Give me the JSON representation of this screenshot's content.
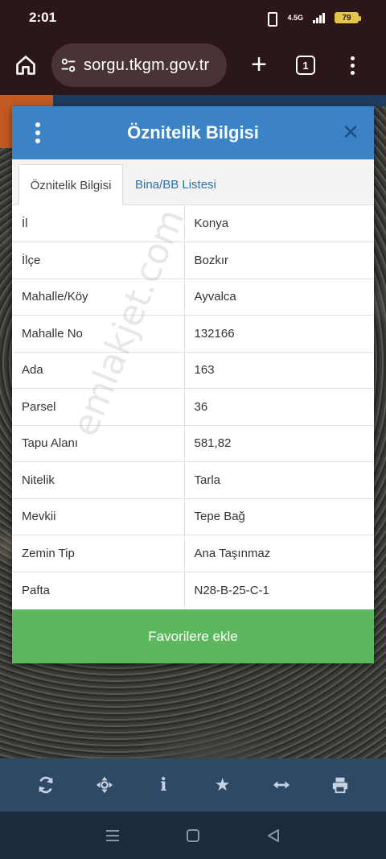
{
  "status_bar": {
    "time": "2:01",
    "network": "4.5G",
    "battery": "79"
  },
  "browser": {
    "url": "sorgu.tkgm.gov.tr",
    "tab_count": "1"
  },
  "dialog": {
    "title": "Öznitelik Bilgisi",
    "close_label": "✕",
    "tabs": [
      {
        "label": "Öznitelik Bilgisi",
        "active": true
      },
      {
        "label": "Bina/BB Listesi",
        "active": false
      }
    ],
    "rows": [
      {
        "key": "İl",
        "value": "Konya"
      },
      {
        "key": "İlçe",
        "value": "Bozkır"
      },
      {
        "key": "Mahalle/Köy",
        "value": "Ayvalca"
      },
      {
        "key": "Mahalle No",
        "value": "132166"
      },
      {
        "key": "Ada",
        "value": "163"
      },
      {
        "key": "Parsel",
        "value": "36"
      },
      {
        "key": "Tapu Alanı",
        "value": "581,82"
      },
      {
        "key": "Nitelik",
        "value": "Tarla"
      },
      {
        "key": "Mevkii",
        "value": "Tepe Bağ"
      },
      {
        "key": "Zemin Tip",
        "value": "Ana Taşınmaz"
      },
      {
        "key": "Pafta",
        "value": "N28-B-25-C-1"
      }
    ],
    "favorite_button": "Favorilere ekle"
  },
  "watermark": "emlakjet.com",
  "toolbar": {
    "icons": [
      "refresh-icon",
      "move-icon",
      "info-icon",
      "star-icon",
      "measure-icon",
      "print-icon"
    ]
  },
  "colors": {
    "header_blue": "#3c82c7",
    "favorite_green": "#5cb85c",
    "tab_link_blue": "#2a6fb1",
    "toolbar_blue": "#2d4966"
  }
}
